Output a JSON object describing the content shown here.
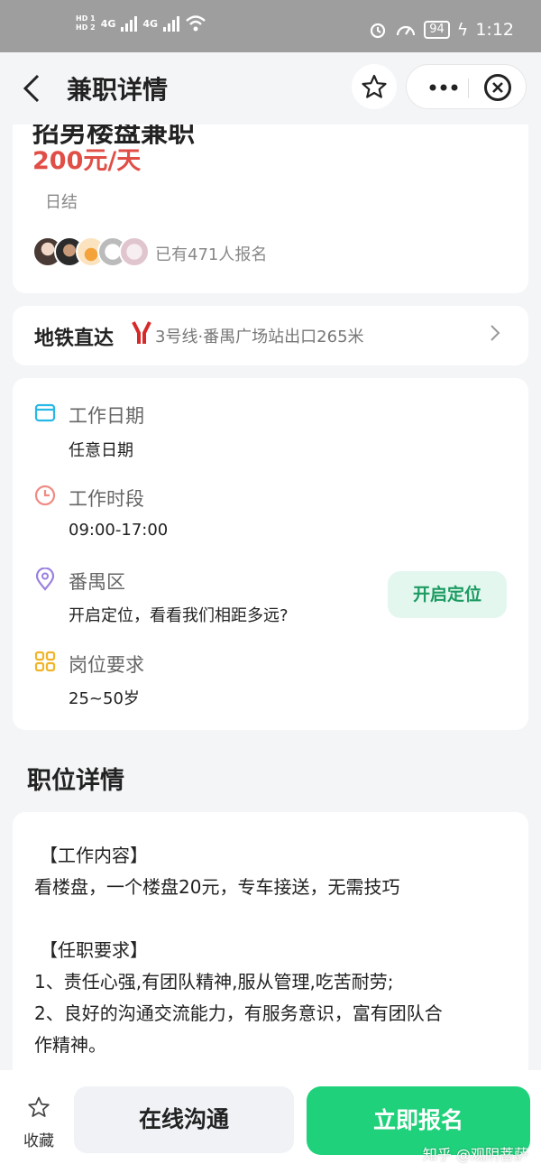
{
  "status_bar": {
    "hd1": "HD 1",
    "hd2": "HD 2",
    "network1": "4G",
    "network2": "4G",
    "battery": "94",
    "time": "1:12"
  },
  "header": {
    "title": "兼职详情",
    "back_icon": "chevron-left-icon",
    "star_icon": "star-outline-icon",
    "more_icon": "more-dots-icon",
    "close_icon": "close-circle-icon"
  },
  "job": {
    "title_cut": "招男楼盘兼职",
    "price": "200元/天",
    "settlement": "日结",
    "enrolled": "已有471人报名"
  },
  "metro": {
    "title": "地铁直达",
    "description": "3号线·番禺广场站出口265米"
  },
  "info": {
    "date_label": "工作日期",
    "date_value": "任意日期",
    "time_label": "工作时段",
    "time_value": "09:00-17:00",
    "location_label": "番禺区",
    "location_value": "开启定位，看看我们相距多远?",
    "location_button": "开启定位",
    "requirement_label": "岗位要求",
    "requirement_value": "25~50岁"
  },
  "details": {
    "section_title": "职位详情",
    "lines": [
      "【工作内容】",
      "看楼盘，一个楼盘20元，专车接送，无需技巧",
      "",
      "【任职要求】",
      "1、责任心强,有团队精神,服从管理,吃苦耐劳;",
      "2、良好的沟通交流能力，有服务意识，富有团队合",
      "作精神。"
    ]
  },
  "bottom": {
    "favorite_label": "收藏",
    "chat_button": "在线沟通",
    "apply_button": "立即报名",
    "watermark": "知乎 @观阴菩萨"
  },
  "colors": {
    "price": "#e04e46",
    "accent_green": "#1fd17a",
    "locate_green": "#1d9b62",
    "metro_red": "#d62a2a"
  }
}
